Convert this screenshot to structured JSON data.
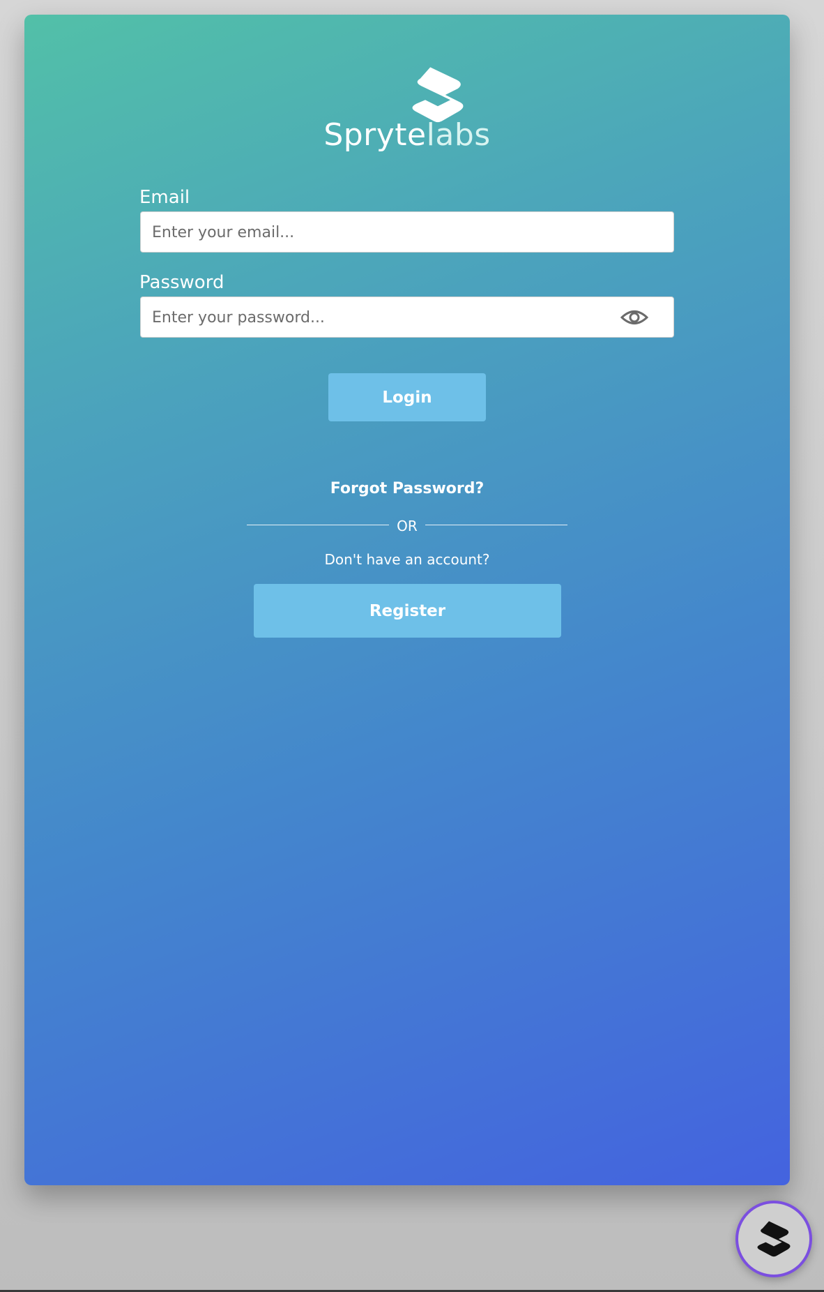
{
  "brand": {
    "name_bold": "Spryte",
    "name_light": "labs",
    "logo_icon": "s-logo-icon"
  },
  "form": {
    "email": {
      "label": "Email",
      "placeholder": "Enter your email...",
      "value": ""
    },
    "password": {
      "label": "Password",
      "placeholder": "Enter your password...",
      "value": "",
      "toggle_icon": "eye-icon"
    },
    "login_label": "Login"
  },
  "links": {
    "forgot_password": "Forgot Password?",
    "or_text": "OR",
    "no_account": "Don't have an account?",
    "register_label": "Register"
  },
  "fab": {
    "icon": "s-logo-icon",
    "border_color": "#7b4fe0"
  },
  "colors": {
    "gradient_start": "#52c0a8",
    "gradient_end": "#4463df",
    "button_bg": "#6ec0e8"
  }
}
